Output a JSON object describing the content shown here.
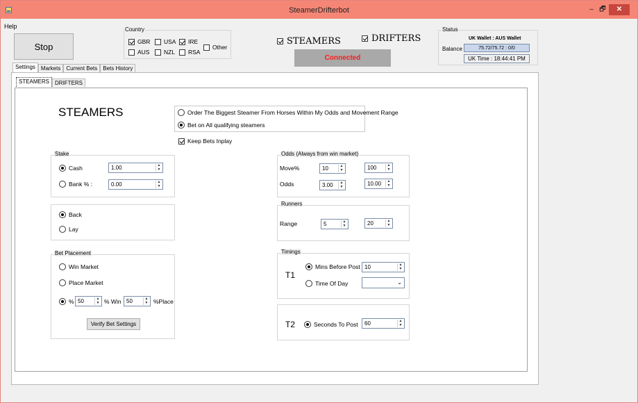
{
  "window": {
    "title": "SteamerDrifterbot",
    "min": "–",
    "max": "🗗",
    "close": "✕"
  },
  "menu": {
    "help": "Help"
  },
  "main_button": "Stop",
  "country": {
    "caption": "Country",
    "items": [
      {
        "label": "GBR",
        "checked": true
      },
      {
        "label": "USA",
        "checked": false
      },
      {
        "label": "IRE",
        "checked": true
      },
      {
        "label": "AUS",
        "checked": false
      },
      {
        "label": "NZL",
        "checked": false
      },
      {
        "label": "RSA",
        "checked": false
      }
    ],
    "other": {
      "label": "Other",
      "checked": false
    }
  },
  "mode": {
    "steamers": "STEAMERS",
    "drifters": "DRIFTERS"
  },
  "connection": "Connected",
  "status": {
    "caption": "Status",
    "wallet": "UK Wallet : AUS Wallet",
    "balance_label": "Balance",
    "balance_value": "75.72/75.72 : 0/0",
    "time": "UK Time : 18:44:41 PM"
  },
  "tabs": [
    "Settings",
    "Markets",
    "Current Bets",
    "Bets History"
  ],
  "subtabs": [
    "STEAMERS",
    "DRIFTERS"
  ],
  "heading": "STEAMERS",
  "order_options": {
    "biggest": "Order The Biggest Steamer From Horses Within My Odds and Movement Range",
    "all": "Bet on All qualifying steamers"
  },
  "keep_inplay": "Keep Bets Inplay",
  "stake": {
    "caption": "Stake",
    "cash_label": "Cash",
    "cash_value": "1.00",
    "bank_label": "Bank % :",
    "bank_value": "0.00"
  },
  "side": {
    "back": "Back",
    "lay": "Lay"
  },
  "bet_placement": {
    "caption": "Bet Placement",
    "win": "Win Market",
    "place": "Place Market",
    "pct_label": "%",
    "pct_win_value": "50",
    "pct_win_label": "% Win",
    "pct_place_value": "50",
    "pct_place_label": "%Place",
    "verify": "Verify Bet Settings"
  },
  "odds": {
    "caption": "Odds (Always from win market)",
    "move_label": "Move%",
    "move_min": "10",
    "move_max": "100",
    "odds_label": "Odds",
    "odds_min": "3.00",
    "odds_max": "10.00"
  },
  "runners": {
    "caption": "Runners",
    "range_label": "Range",
    "min": "5",
    "max": "20"
  },
  "timings": {
    "caption": "Timings",
    "t1": "T1",
    "mins_before_post": "Mins Before Post",
    "mins_value": "10",
    "time_of_day": "Time Of Day",
    "t2": "T2",
    "seconds_to_post": "Seconds To Post",
    "seconds_value": "60"
  }
}
